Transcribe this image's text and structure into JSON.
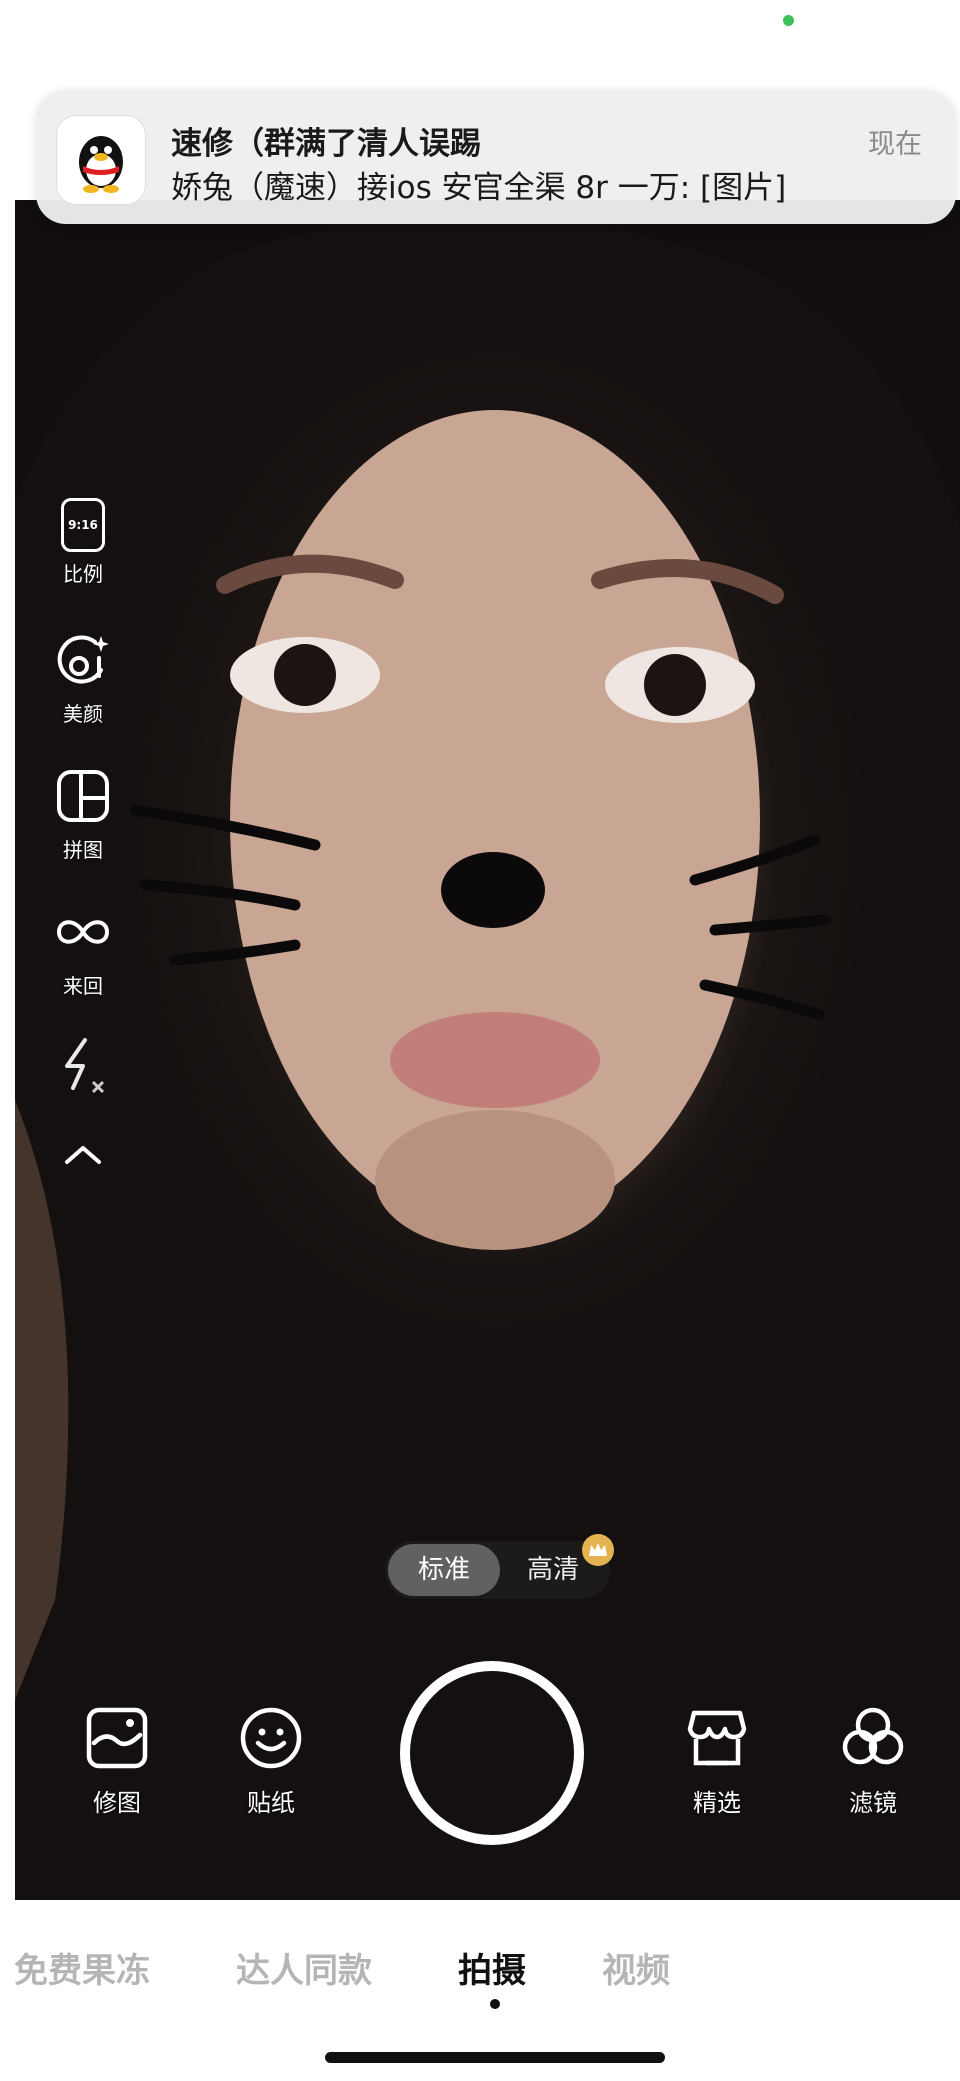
{
  "notification": {
    "app_icon": "qq-penguin-icon",
    "title": "速修（群满了清人误踢",
    "body": "娇兔（魔速）接ios 安官全渠 8r 一万: [图片]",
    "time": "现在"
  },
  "toolbar": {
    "items": [
      {
        "icon": "aspect-ratio-icon",
        "icon_text": "9:16",
        "label": "比例"
      },
      {
        "icon": "beauty-face-icon",
        "label": "美颜"
      },
      {
        "icon": "collage-grid-icon",
        "label": "拼图"
      },
      {
        "icon": "boomerang-loop-icon",
        "label": "来回"
      },
      {
        "icon": "flash-off-icon"
      },
      {
        "icon": "chevron-up-icon"
      }
    ]
  },
  "quality": {
    "standard": "标准",
    "hd": "高清",
    "hd_badge": "crown-icon"
  },
  "controls": {
    "edit": {
      "icon": "photo-edit-icon",
      "label": "修图"
    },
    "stickers": {
      "icon": "sticker-smile-icon",
      "label": "贴纸"
    },
    "featured": {
      "icon": "store-icon",
      "label": "精选"
    },
    "filters": {
      "icon": "filter-circles-icon",
      "label": "滤镜"
    }
  },
  "modes": {
    "tabs": [
      "免费果冻",
      "达人同款",
      "拍摄",
      "视频"
    ],
    "active": "拍摄"
  },
  "colors": {
    "status_dot": "#3cc05a",
    "crown": "#e2b34f",
    "shutter_ring": "#ffffff"
  }
}
